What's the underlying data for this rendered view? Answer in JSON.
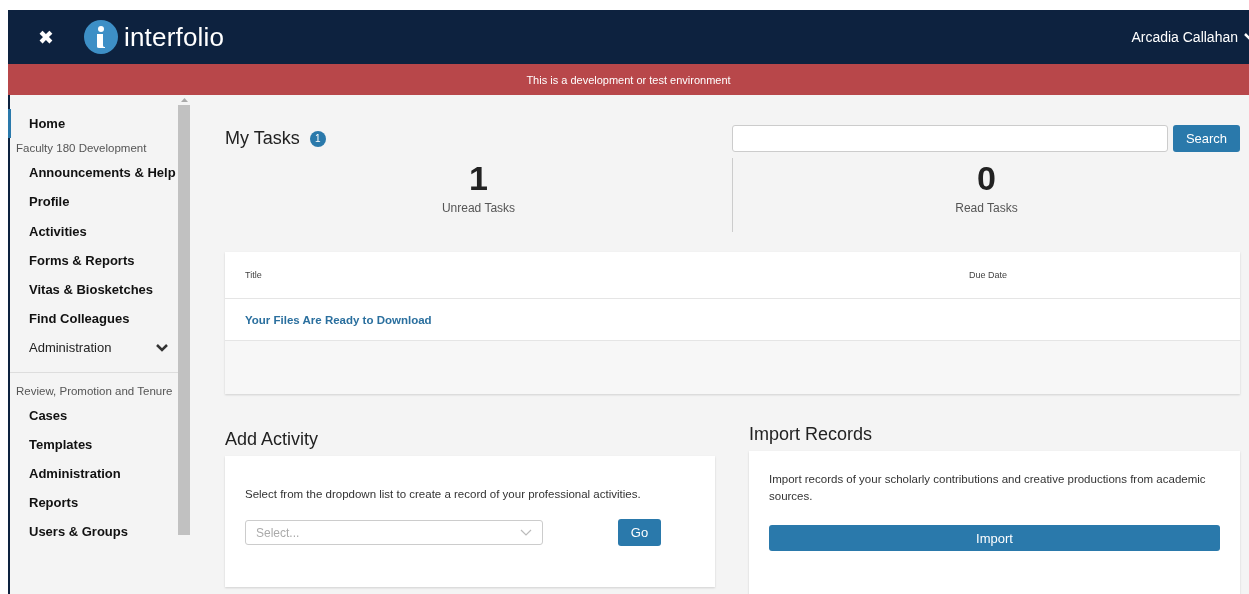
{
  "topbar": {
    "close": "✖",
    "logo_text": "interfolio",
    "user": "Arcadia Callahan"
  },
  "banner": "This is a development or test environment",
  "sidebar": {
    "items": [
      {
        "kind": "link",
        "label": "Home",
        "selected": true
      },
      {
        "kind": "heading",
        "label": "Faculty 180 Development"
      },
      {
        "kind": "link",
        "label": "Announcements & Help",
        "selected": false
      },
      {
        "kind": "link",
        "label": "Profile",
        "selected": false
      },
      {
        "kind": "link",
        "label": "Activities",
        "selected": false
      },
      {
        "kind": "link",
        "label": "Forms & Reports",
        "selected": false
      },
      {
        "kind": "link",
        "label": "Vitas & Biosketches",
        "selected": false
      },
      {
        "kind": "link",
        "label": "Find Colleagues",
        "selected": false
      },
      {
        "kind": "group",
        "label": "Administration",
        "selected": false,
        "expanded": false
      },
      {
        "kind": "divider"
      },
      {
        "kind": "heading",
        "label": "Review, Promotion and Tenure"
      },
      {
        "kind": "link",
        "label": "Cases",
        "selected": false
      },
      {
        "kind": "link",
        "label": "Templates",
        "selected": false
      },
      {
        "kind": "link",
        "label": "Administration",
        "selected": false
      },
      {
        "kind": "link",
        "label": "Reports",
        "selected": false
      },
      {
        "kind": "link",
        "label": "Users & Groups",
        "selected": false
      }
    ]
  },
  "tasks": {
    "title": "My Tasks",
    "badge": "1",
    "search_button": "Search",
    "stats": [
      {
        "value": "1",
        "label": "Unread Tasks"
      },
      {
        "value": "0",
        "label": "Read Tasks"
      }
    ],
    "table": {
      "columns": [
        "Title",
        "Due Date"
      ],
      "rows": [
        {
          "title": "Your Files Are Ready to Download",
          "due_date": ""
        }
      ]
    }
  },
  "add_activity": {
    "title": "Add Activity",
    "text": "Select from the dropdown list to create a record of your professional activities.",
    "select_placeholder": "Select...",
    "button": "Go"
  },
  "import_records": {
    "title": "Import Records",
    "text": "Import records of your scholarly contributions and creative productions from academic sources.",
    "button": "Import"
  }
}
